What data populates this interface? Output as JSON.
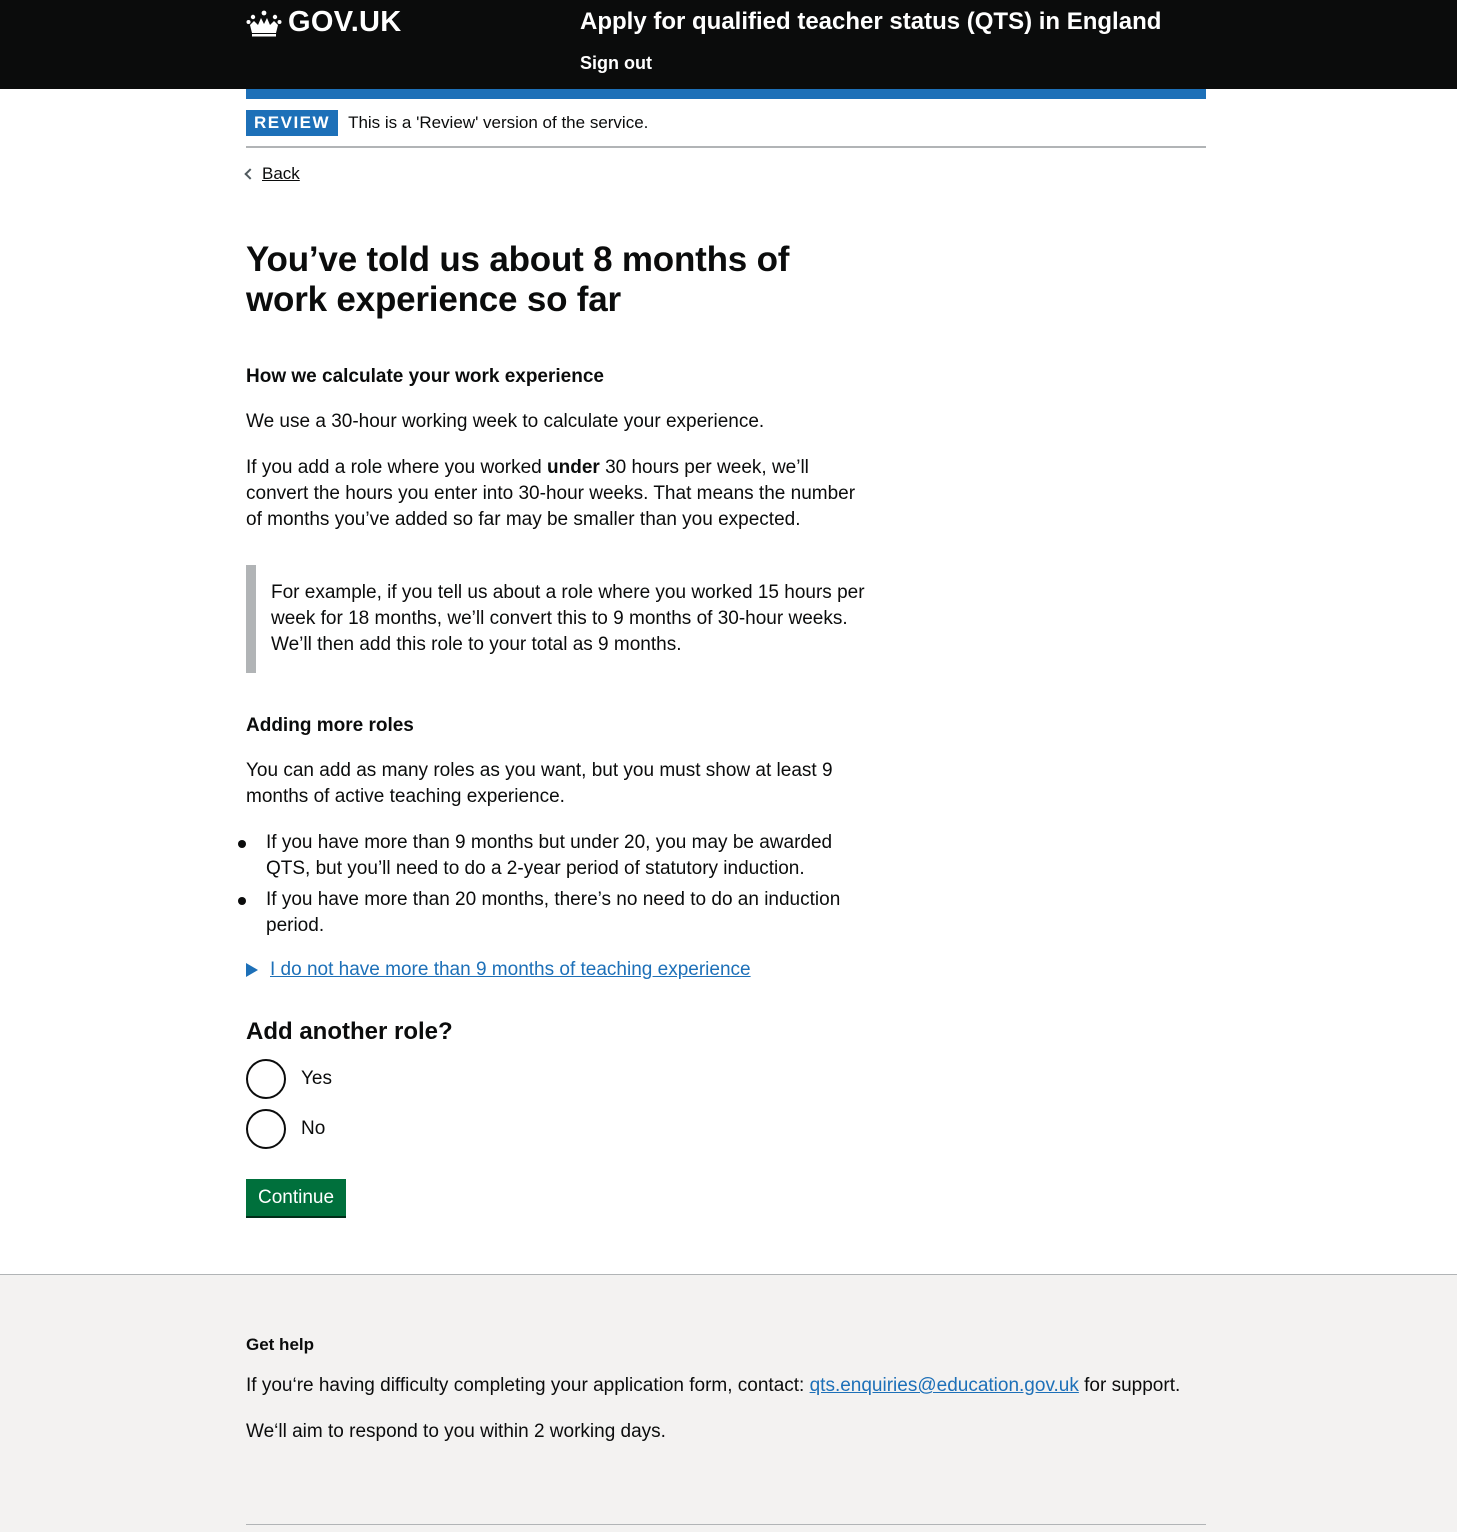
{
  "header": {
    "logo_text": "GOV.UK",
    "service_name": "Apply for qualified teacher status (QTS) in England",
    "sign_out": "Sign out"
  },
  "phase_banner": {
    "tag": "REVIEW",
    "text": "This is a 'Review' version of the service."
  },
  "back_link": "Back",
  "main": {
    "heading": "You’ve told us about 8 months of work experience so far",
    "calc_heading": "How we calculate your work experience",
    "calc_p1": "We use a 30-hour working week to calculate your experience.",
    "calc_p2_before": "If you add a role where you worked ",
    "calc_p2_bold": "under",
    "calc_p2_after": " 30 hours per week, we’ll convert the hours you enter into 30-hour weeks. That means the number of months you’ve added so far may be smaller than you expected.",
    "inset_text": "For example, if you tell us about a role where you worked 15 hours per week for 18 months, we’ll convert this to 9 months of 30-hour weeks. We’ll then add this role to your total as 9 months.",
    "roles_heading": "Adding more roles",
    "roles_p": "You can add as many roles as you want, but you must show at least 9 months of active teaching experience.",
    "bullets": [
      "If you have more than 9 months but under 20, you may be awarded QTS, but you’ll need to do a 2-year period of statutory induction.",
      "If you have more than 20 months, there’s no need to do an induction period."
    ],
    "details_summary": "I do not have more than 9 months of teaching experience",
    "question": "Add another role?",
    "options": [
      "Yes",
      "No"
    ],
    "continue_button": "Continue"
  },
  "footer": {
    "heading": "Get help",
    "help_before": "If you‘re having difficulty completing your application form, contact: ",
    "help_email": "qts.enquiries@education.gov.uk",
    "help_after": " for support.",
    "response_text": "We‘ll aim to respond to you within 2 working days."
  },
  "colors": {
    "header_bg": "#0b0c0c",
    "brand_blue": "#1d70b8",
    "button_green": "#00703c",
    "footer_bg": "#f3f2f1"
  }
}
